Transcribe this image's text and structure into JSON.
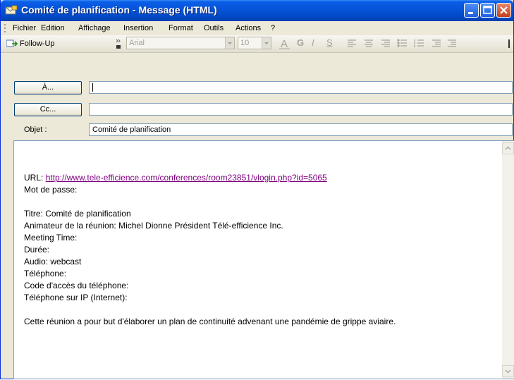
{
  "window": {
    "title": "Comité de planification - Message (HTML)"
  },
  "menu": [
    "Fichier",
    "Edition",
    "Affichage",
    "Insertion",
    "Format",
    "Outils",
    "Actions",
    "?"
  ],
  "toolbar": {
    "followup_label": "Follow-Up",
    "font_name": "Arial",
    "font_size": "10",
    "bold": "G",
    "italic": "I",
    "underline": "S"
  },
  "header": {
    "to_label": "À...",
    "to_value": "",
    "cc_label": "Cc...",
    "cc_value": "",
    "subject_label": "Objet :",
    "subject_value": "Comité de planification"
  },
  "body": {
    "url_label": "URL:",
    "url_link": "http://www.tele-efficience.com/conferences/room23851/vlogin.php?id=5065",
    "password": "Mot de passe:",
    "title_line": "Titre: Comité de planification",
    "host_line": "Animateur de la réunion: Michel Dionne Président Télé-efficience Inc.",
    "meeting_time": "Meeting Time:",
    "duration": "Durée:",
    "audio": "Audio: webcast",
    "phone": "Téléphone:",
    "phone_code": "Code d'accès du téléphone:",
    "phone_ip": "Téléphone sur IP (Internet):",
    "purpose": "Cette réunion a pour but d'élaborer un plan de continuité advenant une pandémie de grippe aviaire."
  }
}
